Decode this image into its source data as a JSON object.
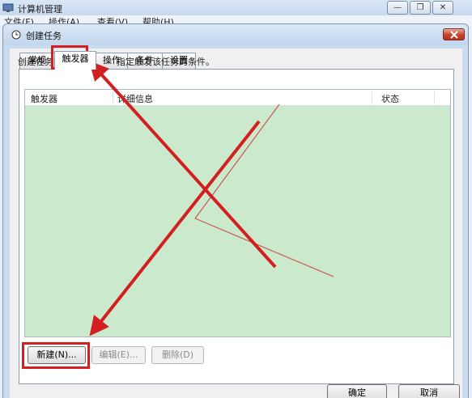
{
  "background_window": {
    "title": "计算机管理",
    "menu": [
      "文件(F)",
      "操作(A)",
      "查看(V)",
      "帮助(H)"
    ],
    "buttons": [
      "minimize-icon",
      "restore-icon",
      "close-icon"
    ]
  },
  "dialog": {
    "title": "创建任务",
    "icon": "clock-icon",
    "tabs": [
      {
        "label": "常规",
        "active": false
      },
      {
        "label": "触发器",
        "active": true
      },
      {
        "label": "操作",
        "active": false
      },
      {
        "label": "条件",
        "active": false
      },
      {
        "label": "设置",
        "active": false
      }
    ],
    "description_left": "创建任务时，可",
    "description_right": "指定触发该任务的条件。",
    "columns": {
      "trigger": "触发器",
      "details": "详细信息",
      "status": "状态"
    },
    "rows": [],
    "buttons": {
      "new": "新建(N)...",
      "edit": "编辑(E)...",
      "delete": "删除(D)"
    },
    "footer": {
      "ok": "确定",
      "cancel": "取消"
    }
  },
  "annotations": {
    "color": "#d31f1f"
  },
  "colors": {
    "list_background": "#cbe9cc",
    "dialog_frame": "#c9dcef"
  }
}
